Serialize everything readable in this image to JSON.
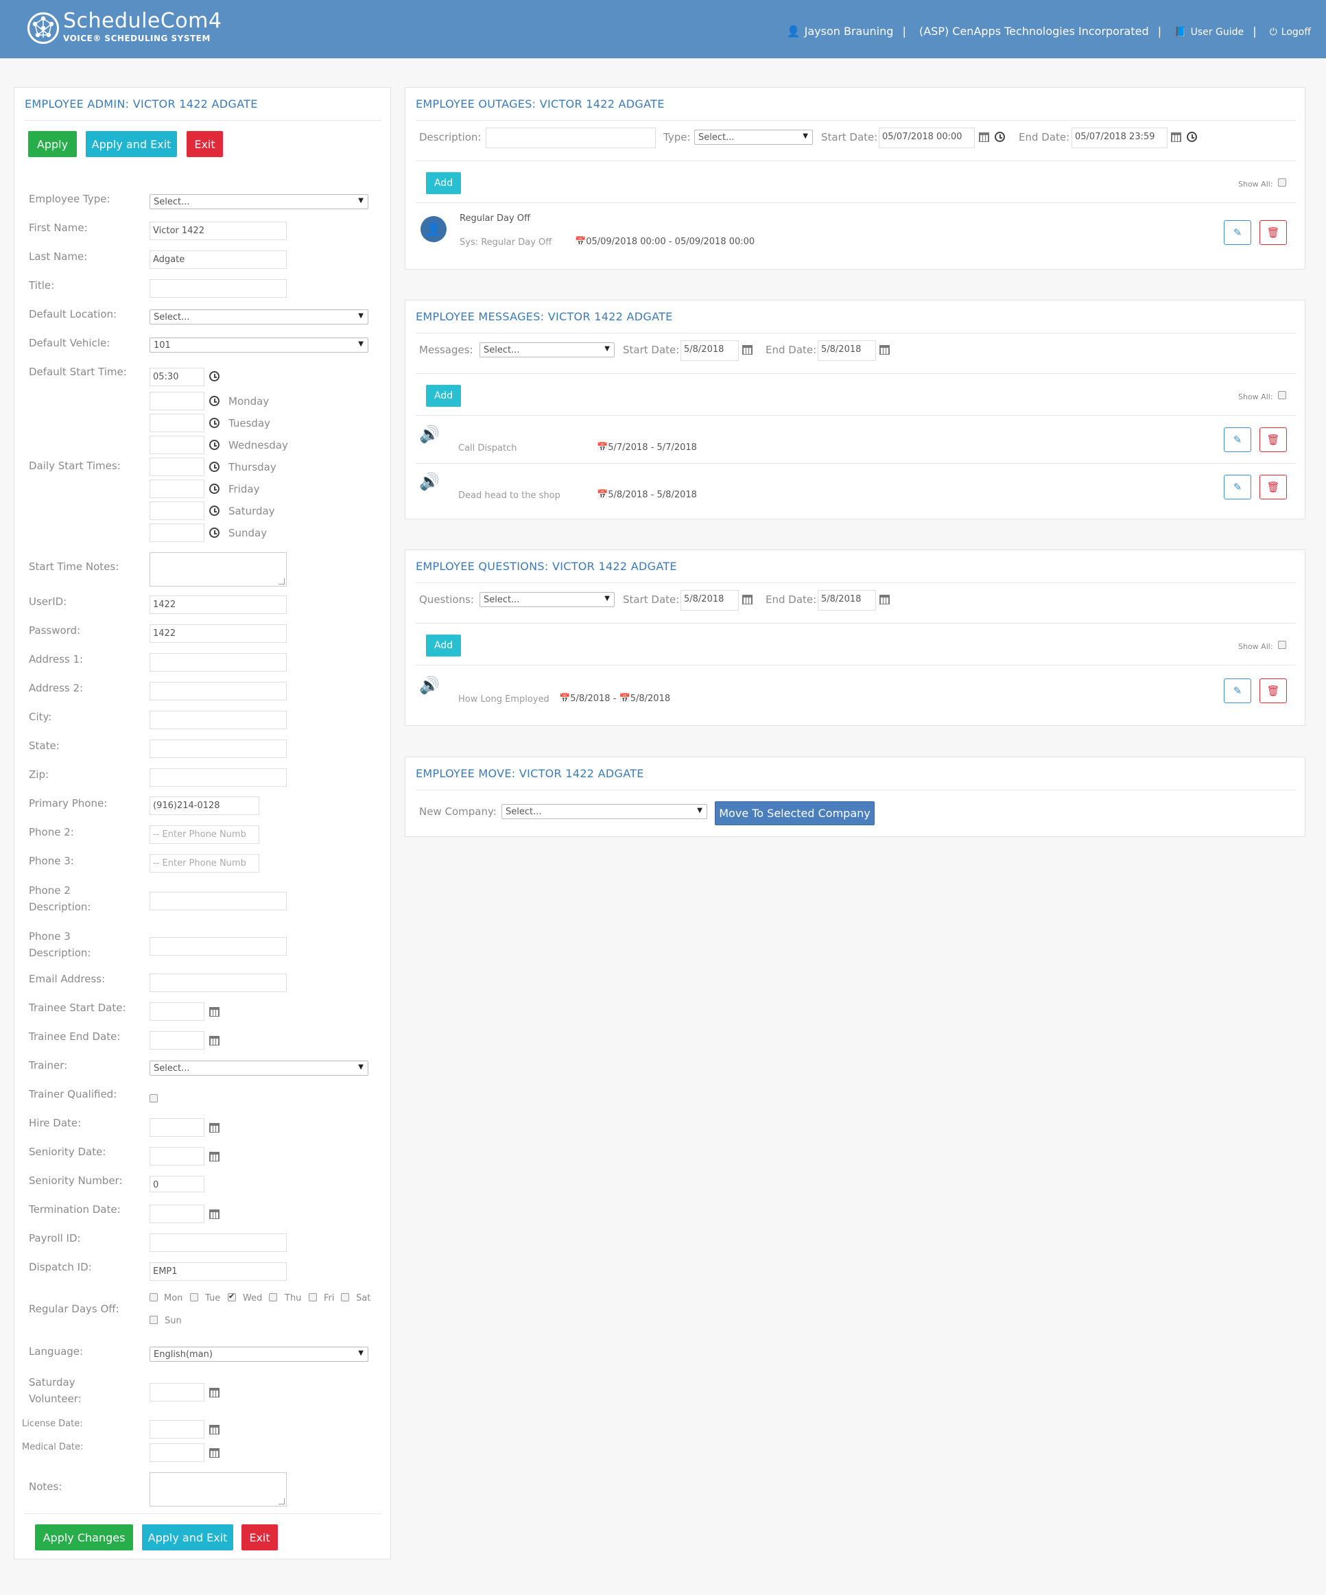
{
  "header": {
    "brand": "ScheduleCom4",
    "tagline": "VOICE® SCHEDULING SYSTEM",
    "user": "Jayson Brauning",
    "company": "(ASP) CenApps Technologies Incorporated",
    "guide": "User Guide",
    "logoff": "Logoff",
    "icons": [
      "user-icon",
      "book-icon",
      "power-icon"
    ]
  },
  "admin": {
    "title": "EMPLOYEE ADMIN: VICTOR 1422 ADGATE",
    "apply": "Apply",
    "apply_exit": "Apply and Exit",
    "exit": "Exit",
    "apply_changes": "Apply Changes",
    "labels": {
      "employee_type": "Employee Type:",
      "first_name": "First Name:",
      "last_name": "Last Name:",
      "title": "Title:",
      "default_location": "Default Location:",
      "default_vehicle": "Default Vehicle:",
      "default_start_time": "Default Start Time:",
      "daily_start_times": "Daily Start Times:",
      "start_time_notes": "Start Time Notes:",
      "userid": "UserID:",
      "password": "Password:",
      "address1": "Address 1:",
      "address2": "Address 2:",
      "city": "City:",
      "state": "State:",
      "zip": "Zip:",
      "primary_phone": "Primary Phone:",
      "phone2": "Phone 2:",
      "phone3": "Phone 3:",
      "phone2_desc": "Phone 2 Description:",
      "phone3_desc": "Phone 3 Description:",
      "email": "Email Address:",
      "trainee_start": "Trainee Start Date:",
      "trainee_end": "Trainee End Date:",
      "trainer": "Trainer:",
      "trainer_qualified": "Trainer Qualified:",
      "hire_date": "Hire Date:",
      "seniority_date": "Seniority Date:",
      "seniority_number": "Seniority Number:",
      "termination_date": "Termination Date:",
      "payroll_id": "Payroll ID:",
      "dispatch_id": "Dispatch ID:",
      "regular_days_off": "Regular Days Off:",
      "language": "Language:",
      "saturday_volunteer": "Saturday Volunteer:",
      "license_date": "License Date:",
      "medical_date": "Medical Date:",
      "notes": "Notes:"
    },
    "values": {
      "employee_type": "Select...",
      "first_name": "Victor 1422",
      "last_name": "Adgate",
      "default_location": "Select...",
      "default_vehicle": "101",
      "default_start_time": "05:30",
      "userid": "1422",
      "password": "1422",
      "primary_phone": "(916)214-0128",
      "phone_placeholder": "-- Enter Phone Numb",
      "trainer": "Select...",
      "seniority_number": "0",
      "dispatch_id": "EMP1",
      "language": "English(man)"
    },
    "days": [
      "Monday",
      "Tuesday",
      "Wednesday",
      "Thursday",
      "Friday",
      "Saturday",
      "Sunday"
    ],
    "days_off": [
      {
        "label": "Mon",
        "checked": false
      },
      {
        "label": "Tue",
        "checked": false
      },
      {
        "label": "Wed",
        "checked": true
      },
      {
        "label": "Thu",
        "checked": false
      },
      {
        "label": "Fri",
        "checked": false
      },
      {
        "label": "Sat",
        "checked": false
      },
      {
        "label": "Sun",
        "checked": false
      }
    ]
  },
  "outages": {
    "title": "EMPLOYEE OUTAGES: VICTOR 1422 ADGATE",
    "description_label": "Description:",
    "type_label": "Type:",
    "type_value": "Select...",
    "start_label": "Start Date:",
    "start_value": "05/07/2018 00:00",
    "end_label": "End Date:",
    "end_value": "05/07/2018 23:59",
    "add": "Add",
    "show_all": "Show All:",
    "item": {
      "name": "Regular Day Off",
      "sub": "Sys: Regular Day Off",
      "range": "05/09/2018 00:00 - 05/09/2018 00:00"
    }
  },
  "messages": {
    "title": "EMPLOYEE MESSAGES: VICTOR 1422 ADGATE",
    "messages_label": "Messages:",
    "messages_value": "Select...",
    "start_label": "Start Date:",
    "start_value": "5/8/2018",
    "end_label": "End Date:",
    "end_value": "5/8/2018",
    "add": "Add",
    "show_all": "Show All:",
    "items": [
      {
        "text": "Call Dispatch",
        "range": "5/7/2018 - 5/7/2018"
      },
      {
        "text": "Dead head to the shop",
        "range": "5/8/2018 - 5/8/2018"
      }
    ]
  },
  "questions": {
    "title": "EMPLOYEE QUESTIONS: VICTOR 1422 ADGATE",
    "questions_label": "Questions:",
    "questions_value": "Select...",
    "start_label": "Start Date:",
    "start_value": "5/8/2018",
    "end_label": "End Date:",
    "end_value": "5/8/2018",
    "add": "Add",
    "show_all": "Show All:",
    "item": {
      "text": "How Long Employed",
      "start": "5/8/2018",
      "end": "5/8/2018"
    }
  },
  "move": {
    "title": "EMPLOYEE MOVE: VICTOR 1422 ADGATE",
    "company_label": "New Company:",
    "company_value": "Select...",
    "button": "Move To Selected Company"
  }
}
